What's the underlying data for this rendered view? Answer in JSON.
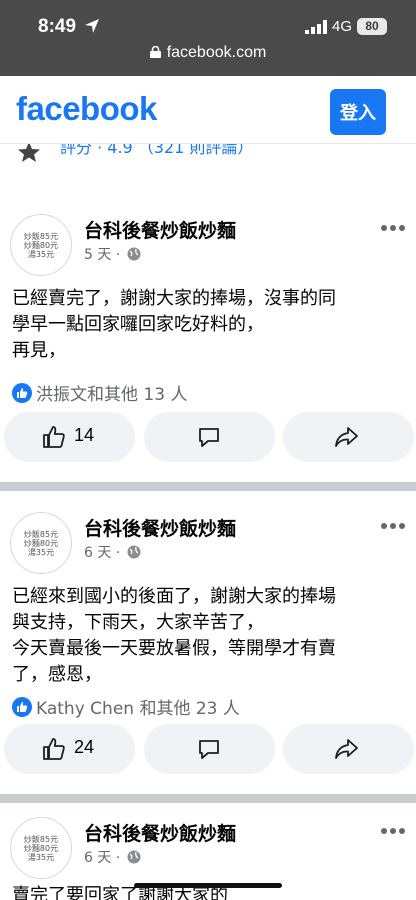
{
  "status_bar": {
    "time": "8:49",
    "network": "4G",
    "battery": "80",
    "url": "facebook.com"
  },
  "header": {
    "logo": "facebook",
    "login_label": "登入",
    "brand_color": "#1877f2"
  },
  "rating": {
    "text": "評分 · 4.9 （321 則評論）"
  },
  "posts": [
    {
      "avatar_text": [
        "炒飯85元",
        "炒麵80元",
        "湯35元"
      ],
      "page_name": "台科後餐炒飯炒麵",
      "time": "5 天",
      "lines": [
        "已經賣完了，謝謝大家的捧場，沒事的同",
        "學早一點回家囉回家吃好料的，",
        "再見，"
      ],
      "reactions": "洪振文和其他 13 人",
      "likes": "14"
    },
    {
      "avatar_text": [
        "炒飯85元",
        "炒麵80元",
        "湯35元"
      ],
      "page_name": "台科後餐炒飯炒麵",
      "time": "6 天",
      "lines": [
        "已經來到國小的後面了，謝謝大家的捧場",
        "與支持，下雨天，大家辛苦了，",
        "今天賣最後一天要放暑假，等開學才有賣",
        "了，感恩，"
      ],
      "reactions": "Kathy Chen 和其他 23 人",
      "likes": "24"
    },
    {
      "avatar_text": [
        "炒飯85元",
        "炒麵80元",
        "湯35元"
      ],
      "page_name": "台科後餐炒飯炒麵",
      "time": "6 天",
      "lines": [
        "賣完了要回家了謝謝大家的"
      ]
    }
  ]
}
